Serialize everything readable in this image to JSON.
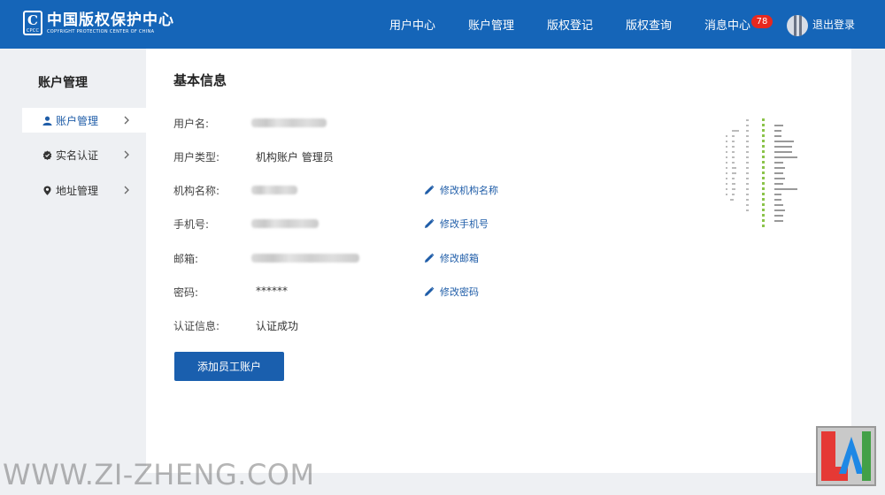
{
  "header": {
    "logo_cn": "中国版权保护中心",
    "logo_en": "COPYRIGHT PROTECTION CENTER OF CHINA",
    "logo_mark": "C",
    "logo_mark_sub": "CPCC",
    "nav": {
      "user_center": "用户中心",
      "account_mgmt": "账户管理",
      "copyright_reg": "版权登记",
      "copyright_query": "版权查询",
      "messages": "消息中心",
      "message_count": "78",
      "logout": "退出登录"
    }
  },
  "sidebar": {
    "title": "账户管理",
    "items": [
      {
        "label": "账户管理",
        "icon": "user-icon"
      },
      {
        "label": "实名认证",
        "icon": "badge-check-icon"
      },
      {
        "label": "地址管理",
        "icon": "location-pin-icon"
      }
    ]
  },
  "main": {
    "title": "基本信息",
    "rows": {
      "username": {
        "label": "用户名:"
      },
      "user_type": {
        "label": "用户类型:",
        "value": "机构账户 管理员"
      },
      "org_name": {
        "label": "机构名称:",
        "edit": "修改机构名称"
      },
      "phone": {
        "label": "手机号:",
        "edit": "修改手机号"
      },
      "email": {
        "label": "邮箱:",
        "edit": "修改邮箱"
      },
      "password": {
        "label": "密码:",
        "value": "******",
        "edit": "修改密码"
      },
      "cert": {
        "label": "认证信息:",
        "value": "认证成功"
      }
    },
    "add_button": "添加员工账户"
  },
  "watermark": "WWW.ZI-ZHENG.COM",
  "colors": {
    "brand": "#1565b8",
    "link": "#1f5da8",
    "badge": "#e8281e",
    "button": "#1a5fae"
  }
}
